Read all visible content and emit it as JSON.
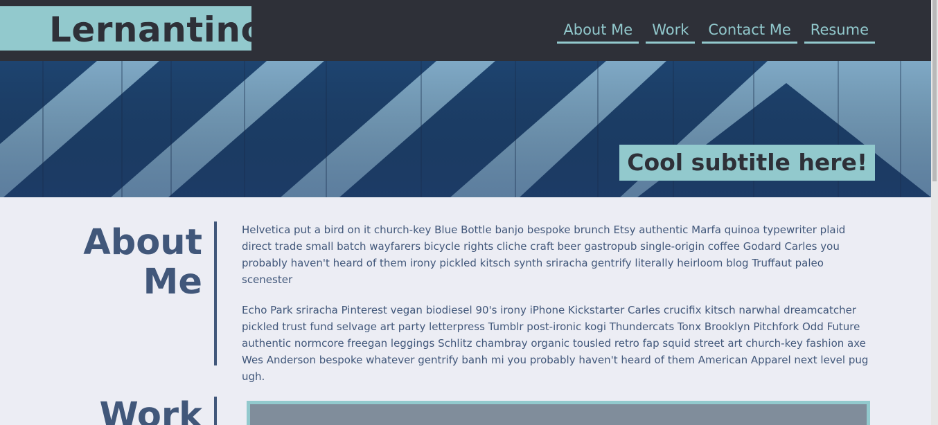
{
  "header": {
    "logo": "Lernantino",
    "nav": [
      {
        "label": "About Me"
      },
      {
        "label": "Work"
      },
      {
        "label": "Contact Me"
      },
      {
        "label": "Resume"
      }
    ]
  },
  "hero": {
    "subtitle": "Cool subtitle here!"
  },
  "about": {
    "heading_line1": "About",
    "heading_line2": "Me",
    "paragraphs": [
      "Helvetica put a bird on it church-key Blue Bottle banjo bespoke brunch Etsy authentic Marfa quinoa typewriter plaid direct trade small batch wayfarers bicycle rights cliche craft beer gastropub single-origin coffee Godard Carles you probably haven't heard of them irony pickled kitsch synth sriracha gentrify literally heirloom blog Truffaut paleo scenester",
      "Echo Park sriracha Pinterest vegan biodiesel 90's irony iPhone Kickstarter Carles crucifix kitsch narwhal dreamcatcher pickled trust fund selvage art party letterpress Tumblr post-ironic kogi Thundercats Tonx Brooklyn Pitchfork Odd Future authentic normcore freegan leggings Schlitz chambray organic tousled retro fap squid street art church-key fashion axe Wes Anderson bespoke whatever gentrify banh mi you probably haven't heard of them American Apparel next level pug ugh."
    ]
  },
  "work": {
    "heading": "Work"
  },
  "colors": {
    "header_bg": "#2E3038",
    "accent": "#92C9CD",
    "heading": "#41577A",
    "page_bg": "#ECEDF4"
  }
}
